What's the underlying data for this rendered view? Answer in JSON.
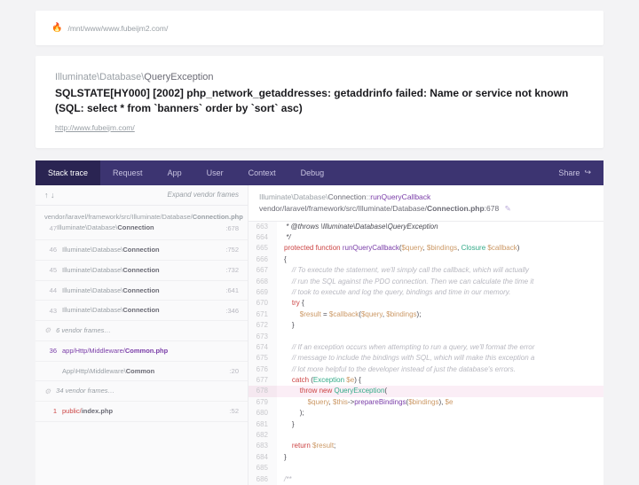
{
  "top": {
    "flame": "🔥",
    "path": "/mnt/www/www.fubeijm2.com/"
  },
  "error": {
    "namespace": "Illuminate\\Database\\",
    "class": "QueryException",
    "message": "SQLSTATE[HY000] [2002] php_network_getaddresses: getaddrinfo failed: Name or service not known (SQL: select * from `banners` order by `sort` asc)",
    "url": "http://www.fubeijm.com/"
  },
  "tabs": {
    "items": [
      "Stack trace",
      "Request",
      "App",
      "User",
      "Context",
      "Debug"
    ],
    "active": 0,
    "share": "Share",
    "share_icon": "↪"
  },
  "frames": {
    "arrows": "↑ ↓",
    "expand": "Expand vendor frames",
    "list": [
      {
        "type": "top",
        "path": "vendor/laravel/framework/src/Illuminate/Database/",
        "file": "Connection.php",
        "num": "47",
        "cls": "Illuminate\\Database\\",
        "bold": "Connection",
        "line": ":678"
      },
      {
        "type": "vendor",
        "num": "46",
        "cls": "Illuminate\\Database\\",
        "bold": "Connection",
        "line": ":752"
      },
      {
        "type": "vendor",
        "num": "45",
        "cls": "Illuminate\\Database\\",
        "bold": "Connection",
        "line": ":732"
      },
      {
        "type": "vendor",
        "num": "44",
        "cls": "Illuminate\\Database\\",
        "bold": "Connection",
        "line": ":641"
      },
      {
        "type": "vendor",
        "num": "43",
        "cls": "Illuminate\\Database\\",
        "bold": "Connection",
        "line": ":346"
      },
      {
        "type": "coll",
        "gear": "⚙",
        "label": "6 vendor frames…"
      },
      {
        "type": "app",
        "num": "36",
        "path": "app/Http/Middleware/",
        "bold": "Common.php"
      },
      {
        "type": "vendor",
        "num": "",
        "cls": "App\\Http\\Middleware\\",
        "bold": "Common",
        "line": ":20"
      },
      {
        "type": "coll",
        "gear": "⚙",
        "label": "34 vendor frames…"
      },
      {
        "type": "idx",
        "num": "1",
        "path": "public/",
        "bold": "index.php",
        "line": ":52"
      }
    ]
  },
  "codeHeader": {
    "ns": "Illuminate\\Database\\",
    "cls": "Connection",
    "sep": "::",
    "method": "runQueryCallback",
    "filepath": "vendor/laravel/framework/src/Illuminate/Database/",
    "file": "Connection.php",
    "lineSuffix": ":678",
    "pencil": "✎"
  },
  "code": {
    "start": 663,
    "highlight": 678,
    "lines": [
      {
        "n": 663,
        "h": " * @throws \\Illuminate\\Database\\QueryException",
        "cls": "c-cmt"
      },
      {
        "n": 664,
        "h": " */",
        "cls": "c-cmt"
      },
      {
        "n": 665,
        "h": "<span class='c-kw'>protected function</span> <span class='c-fn'>runQueryCallback</span>(<span class='c-var'>$query</span>, <span class='c-var'>$bindings</span>, <span class='c-cls'>Closure</span> <span class='c-var'>$callback</span>)"
      },
      {
        "n": 666,
        "h": "{"
      },
      {
        "n": 667,
        "h": "    <span class='c-cmt'>// To execute the statement, we'll simply call the callback, which will actually</span>"
      },
      {
        "n": 668,
        "h": "    <span class='c-cmt'>// run the SQL against the PDO connection. Then we can calculate the time it</span>"
      },
      {
        "n": 669,
        "h": "    <span class='c-cmt'>// took to execute and log the query, bindings and time in our memory.</span>"
      },
      {
        "n": 670,
        "h": "    <span class='c-kw'>try</span> {"
      },
      {
        "n": 671,
        "h": "        <span class='c-var'>$result</span> = <span class='c-var'>$callback</span>(<span class='c-var'>$query</span>, <span class='c-var'>$bindings</span>);"
      },
      {
        "n": 672,
        "h": "    }"
      },
      {
        "n": 673,
        "h": ""
      },
      {
        "n": 674,
        "h": "    <span class='c-cmt'>// If an exception occurs when attempting to run a query, we'll format the error</span>"
      },
      {
        "n": 675,
        "h": "    <span class='c-cmt'>// message to include the bindings with SQL, which will make this exception a</span>"
      },
      {
        "n": 676,
        "h": "    <span class='c-cmt'>// lot more helpful to the developer instead of just the database's errors.</span>"
      },
      {
        "n": 677,
        "h": "    <span class='c-kw'>catch</span> (<span class='c-cls'>Exception</span> <span class='c-var'>$e</span>) {"
      },
      {
        "n": 678,
        "h": "        <span class='c-kw'>throw new</span> <span class='c-cls'>QueryException</span>("
      },
      {
        "n": 679,
        "h": "            <span class='c-var'>$query</span>, <span class='c-var'>$this</span>-&gt;<span class='c-fn'>prepareBindings</span>(<span class='c-var'>$bindings</span>), <span class='c-var'>$e</span>"
      },
      {
        "n": 680,
        "h": "        );"
      },
      {
        "n": 681,
        "h": "    }"
      },
      {
        "n": 682,
        "h": ""
      },
      {
        "n": 683,
        "h": "    <span class='c-kw'>return</span> <span class='c-var'>$result</span>;"
      },
      {
        "n": 684,
        "h": "}"
      },
      {
        "n": 685,
        "h": ""
      },
      {
        "n": 686,
        "h": "<span class='c-cmt'>/**</span>"
      }
    ]
  }
}
